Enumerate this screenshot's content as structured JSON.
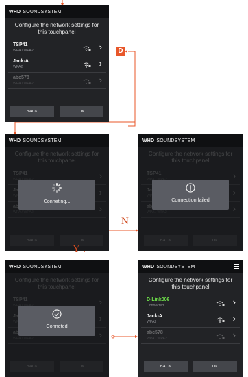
{
  "common": {
    "brand_bold": "WHD",
    "brand_rest": "SOUNDSYSTEM",
    "title_line1": "Configure the network settings for",
    "title_line2": "this touchpanel",
    "back_label": "BACK",
    "ok_label": "OK"
  },
  "networks": [
    {
      "name": "TSP41",
      "security": "WPA / WPA2",
      "signal": "wifi-lock-icon"
    },
    {
      "name": "Jack-A",
      "security": "WPA2",
      "signal": "wifi-lock-icon"
    },
    {
      "name": "abc578",
      "security": "WPA / WPA2",
      "signal": "wifi-lock-icon"
    }
  ],
  "connected_network": {
    "name": "D-Link006",
    "status": "Connected"
  },
  "dialogs": {
    "connecting": "Conneting...",
    "failed": "Connection failed",
    "connected": "Conneted"
  },
  "flow": {
    "badge": "D",
    "no_label": "N",
    "yes_label": "Y"
  },
  "colors": {
    "accent": "#e8572a",
    "connected_green": "#6ee04a",
    "panel_bg": "#222326",
    "header_bg": "#0f1012"
  }
}
